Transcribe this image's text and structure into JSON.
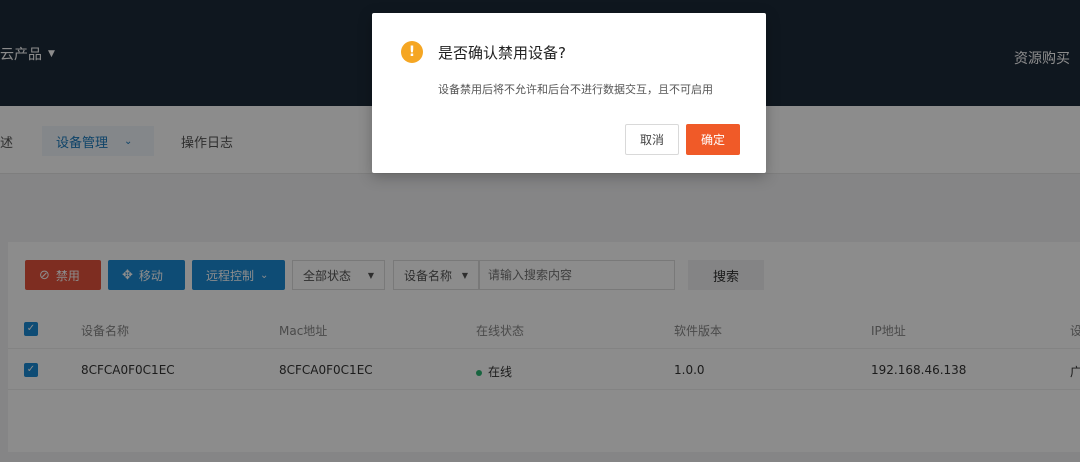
{
  "header": {
    "left_menu": "云产品",
    "right_link": "资源购买"
  },
  "subnav": {
    "left_fragment": "述",
    "active_tab": "设备管理",
    "tab2": "操作日志"
  },
  "toolbar": {
    "disable_label": "禁用",
    "move_label": "移动",
    "remote_label": "远程控制",
    "status_select": "全部状态",
    "field_select": "设备名称",
    "search_placeholder": "请输入搜索内容",
    "search_button": "搜索"
  },
  "table": {
    "headers": [
      "设备名称",
      "Mac地址",
      "在线状态",
      "软件版本",
      "IP地址",
      "设"
    ],
    "rows": [
      {
        "name": "8CFCA0F0C1EC",
        "mac": "8CFCA0F0C1EC",
        "status": "在线",
        "version": "1.0.0",
        "ip": "192.168.46.138",
        "extra": "广"
      }
    ]
  },
  "dialog": {
    "icon_glyph": "!",
    "title": "是否确认禁用设备?",
    "description": "设备禁用后将不允许和后台不进行数据交互，且不可启用",
    "cancel_label": "取消",
    "confirm_label": "确定"
  },
  "colors": {
    "confirm": "#f05a28",
    "warning": "#f5a623",
    "primary": "#1a8ad6",
    "danger": "#e5533d",
    "online": "#2bb673"
  }
}
